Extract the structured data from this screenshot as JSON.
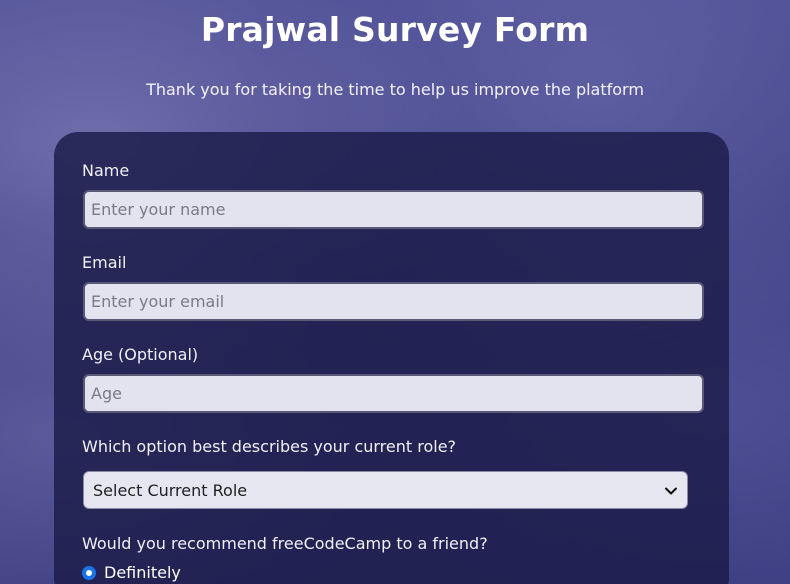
{
  "header": {
    "title": "Prajwal Survey Form",
    "subtitle": "Thank you for taking the time to help us improve the platform"
  },
  "form": {
    "name": {
      "label": "Name",
      "placeholder": "Enter your name",
      "value": ""
    },
    "email": {
      "label": "Email",
      "placeholder": "Enter your email",
      "value": ""
    },
    "age": {
      "label": "Age (Optional)",
      "placeholder": "Age",
      "value": ""
    },
    "role": {
      "label": "Which option best describes your current role?",
      "selected": "Select Current Role",
      "icon": "chevron-down-icon"
    },
    "recommend": {
      "label": "Would you recommend freeCodeCamp to a friend?",
      "options": [
        {
          "label": "Definitely",
          "checked": true
        }
      ]
    }
  },
  "colors": {
    "card_bg": "#1b1b48",
    "input_bg": "#e3e3ef",
    "radio_accent": "#1a73e8",
    "title_text": "#ffffff"
  }
}
